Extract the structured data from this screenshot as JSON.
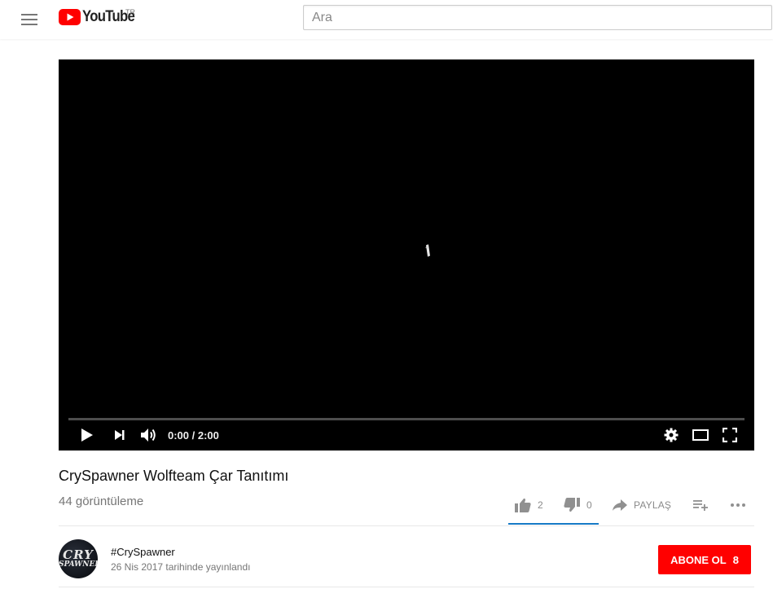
{
  "header": {
    "logo_text": "YouTube",
    "country_code": "TR",
    "search_placeholder": "Ara"
  },
  "player": {
    "current_time": "0:00",
    "separator": " / ",
    "duration": "2:00",
    "progress": 0
  },
  "video": {
    "title": "CrySpawner Wolfteam Çar Tanıtımı",
    "views": "44 görüntüleme",
    "likes": "2",
    "dislikes": "0",
    "share_label": "PAYLAŞ"
  },
  "owner": {
    "channel_name": "#CrySpawner",
    "published": "26 Nis 2017 tarihinde yayınlandı",
    "avatar_line1": "CRY",
    "avatar_line2": "SPAWNER"
  },
  "subscribe": {
    "label": "ABONE OL",
    "count": "8"
  },
  "colors": {
    "brand_red": "#ff0000",
    "accent_blue": "#167ac6"
  },
  "icons": [
    "menu-icon",
    "youtube-logo-icon",
    "play-icon",
    "next-icon",
    "volume-icon",
    "settings-gear-icon",
    "theater-mode-icon",
    "fullscreen-icon",
    "thumbs-up-icon",
    "thumbs-down-icon",
    "share-arrow-icon",
    "add-to-playlist-icon",
    "more-icon"
  ]
}
